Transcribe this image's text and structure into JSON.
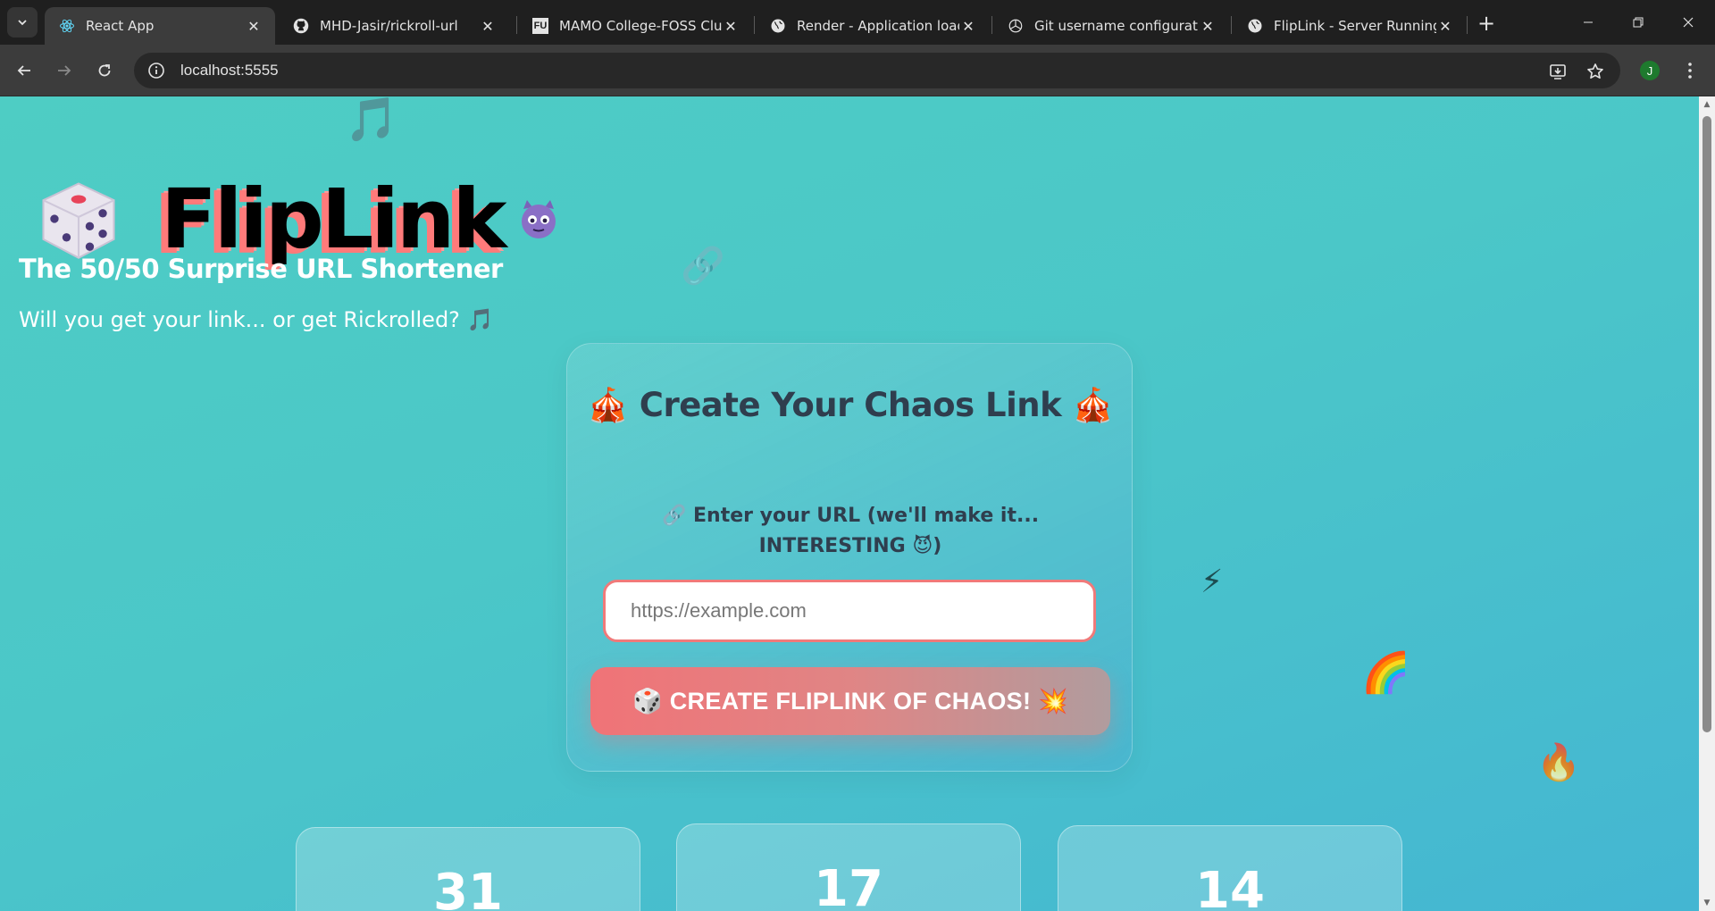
{
  "browser": {
    "tabs": [
      {
        "title": "React App",
        "icon": "react-icon",
        "active": true
      },
      {
        "title": "MHD-Jasir/rickroll-url",
        "icon": "github-icon",
        "active": false
      },
      {
        "title": "MAMO College-FOSS Club",
        "icon": "fu-logo-icon",
        "favicon_text": "FU",
        "active": false
      },
      {
        "title": "Render - Application loadin",
        "icon": "globe-icon",
        "active": false
      },
      {
        "title": "Git username configuration",
        "icon": "openai-icon",
        "active": false
      },
      {
        "title": "FlipLink - Server Running",
        "icon": "globe-icon",
        "active": false
      }
    ],
    "url": "localhost:5555",
    "profile_initial": "J"
  },
  "page": {
    "logo_text": "FlipLink",
    "tagline": "The 50/50 Surprise URL Shortener",
    "subline": "Will you get your link... or get Rickrolled? 🎵",
    "card": {
      "title": "🎪 Create Your Chaos Link 🎪",
      "url_label": "🔗 Enter your URL (we'll make it... INTERESTING 😈)",
      "url_value": "",
      "url_placeholder": "https://example.com",
      "button_label": "🎲 CREATE FLIPLINK OF CHAOS! 💥"
    },
    "stats": [
      {
        "value": "31"
      },
      {
        "value": "17"
      },
      {
        "value": "14"
      }
    ],
    "floating_emojis": [
      "🎵",
      "🔗",
      "⚡",
      "🌈",
      "🔥"
    ]
  },
  "colors": {
    "bg_start": "#4ecdc4",
    "bg_end": "#44b6d2",
    "accent_red": "#f07377",
    "heading_dark": "#2f3e4e"
  }
}
